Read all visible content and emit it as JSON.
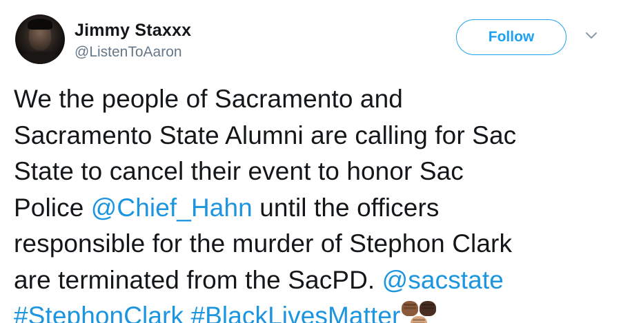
{
  "author": {
    "display_name": "Jimmy Staxxx",
    "handle": "@ListenToAaron"
  },
  "actions": {
    "follow_label": "Follow"
  },
  "tweet": {
    "lines": [
      [
        {
          "text": "We the people of Sacramento and",
          "type": "text"
        }
      ],
      [
        {
          "text": "Sacramento State Alumni are calling for Sac",
          "type": "text"
        }
      ],
      [
        {
          "text": "State to cancel their event to honor Sac",
          "type": "text"
        }
      ],
      [
        {
          "text": "Police ",
          "type": "text"
        },
        {
          "text": "@Chief_Hahn",
          "type": "mention"
        },
        {
          "text": " until the officers",
          "type": "text"
        }
      ],
      [
        {
          "text": "responsible for the murder of Stephon Clark",
          "type": "text"
        }
      ],
      [
        {
          "text": "are terminated from the SacPD. ",
          "type": "text"
        },
        {
          "text": "@sacstate",
          "type": "mention"
        }
      ],
      [
        {
          "text": "#StephonClark",
          "type": "hashtag"
        },
        {
          "text": " ",
          "type": "text"
        },
        {
          "text": "#BlackLivesMatter",
          "type": "hashtag"
        }
      ]
    ],
    "trailing_emoji": "raised-fists-emoji"
  },
  "colors": {
    "link": "#1b95e0",
    "follow_border": "#1da1f2",
    "handle": "#657786",
    "text": "#14171a"
  }
}
